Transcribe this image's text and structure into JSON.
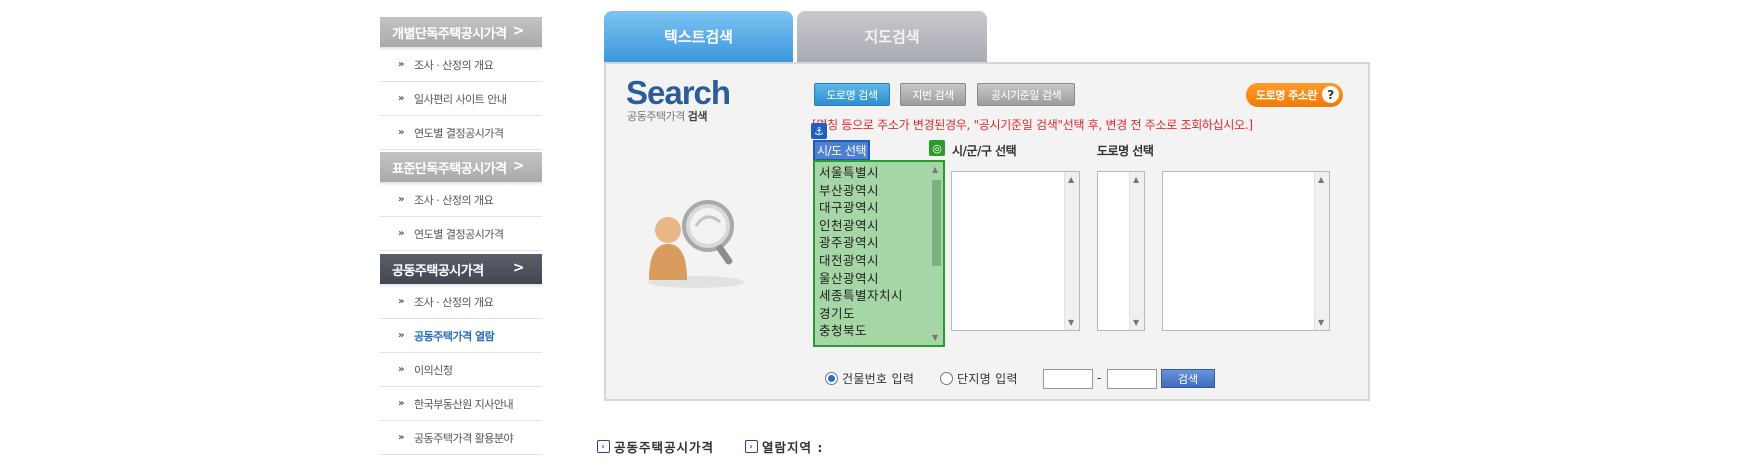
{
  "sidebar": {
    "sections": [
      {
        "title": "개별단독주택공시가격",
        "items": [
          "조사 · 산정의 개요",
          "일사편리 사이트 안내",
          "연도별 결정공시가격"
        ]
      },
      {
        "title": "표준단독주택공시가격",
        "items": [
          "조사 · 산정의 개요",
          "연도별 결정공시가격"
        ]
      },
      {
        "title": "공동주택공시가격",
        "items": [
          "조사 · 산정의 개요",
          "공동주택가격 열람",
          "이의신청",
          "한국부동산원 지사안내",
          "공동주택가격 활용분야"
        ]
      }
    ],
    "chevron": ">",
    "bullet": "»"
  },
  "tabs": {
    "text_search": "텍스트검색",
    "map_search": "지도검색"
  },
  "search": {
    "logo": "Search",
    "sub_normal": "공동주택가격",
    "sub_bold": "검색",
    "buttons": {
      "road": "도로명 검색",
      "lot": "지번 검색",
      "date": "공시기준일 검색"
    },
    "road_help": "도로명 주소란",
    "help_icon": "?",
    "notice": "[명칭 등으로 주소가 변경된경우, \"공시기준일 검색\"선택 후, 변경 전 주소로 조회하십시오.]",
    "labels": {
      "sido": "시/도 선택",
      "sigungu": "시/군/구 선택",
      "road": "도로명 선택"
    },
    "sido_options": [
      "서울특별시",
      "부산광역시",
      "대구광역시",
      "인천광역시",
      "광주광역시",
      "대전광역시",
      "울산광역시",
      "세종특별자치시",
      "경기도",
      "충청북도"
    ],
    "radios": {
      "building": "건물번호 입력",
      "complex": "단지명 입력"
    },
    "dash": "-",
    "search_button": "검색"
  },
  "footer": {
    "price": "공동주택공시가격",
    "region": "열람지역 :"
  },
  "icons": {
    "anchor": "anchor-icon",
    "target": "target-icon",
    "person": "person-search-icon",
    "footer": "arrow-box-icon"
  },
  "colors": {
    "tab_active": "#3d97dd",
    "notice": "#e02b2b",
    "highlight": "#a5d6a6",
    "dark_header": "#414650"
  }
}
